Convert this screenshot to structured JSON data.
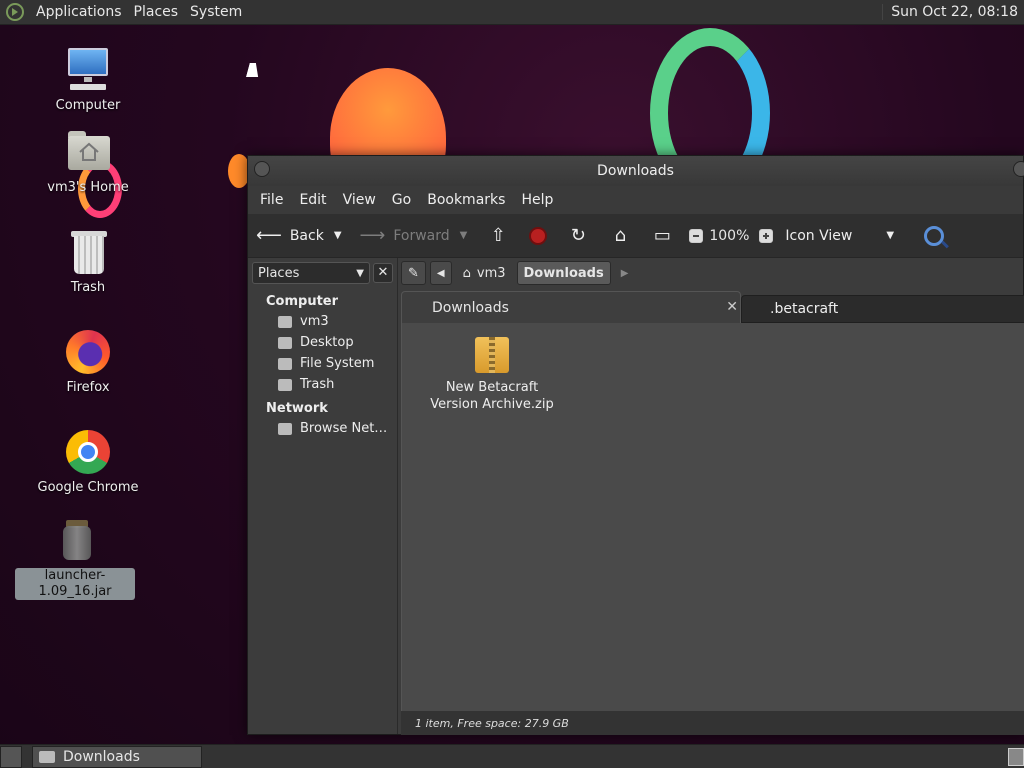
{
  "top_panel": {
    "menu": [
      "Applications",
      "Places",
      "System"
    ],
    "clock": "Sun Oct 22, 08:18"
  },
  "desktop": {
    "icons": [
      {
        "label": "Computer",
        "icon": "computer-icon"
      },
      {
        "label": "vm3's Home",
        "icon": "home-folder-icon"
      },
      {
        "label": "Trash",
        "icon": "trash-icon"
      },
      {
        "label": "Firefox",
        "icon": "firefox-icon"
      },
      {
        "label": "Google Chrome",
        "icon": "chrome-icon"
      },
      {
        "label": "launcher-1.09_16.jar",
        "icon": "jar-file-icon",
        "selected": true
      }
    ]
  },
  "window": {
    "title": "Downloads",
    "menu": [
      "File",
      "Edit",
      "View",
      "Go",
      "Bookmarks",
      "Help"
    ],
    "toolbar": {
      "back": "Back",
      "forward": "Forward",
      "zoom": "100%",
      "view_mode": "Icon View"
    },
    "sidebar": {
      "selector": "Places",
      "sections": [
        {
          "heading": "Computer",
          "items": [
            "vm3",
            "Desktop",
            "File System",
            "Trash"
          ]
        },
        {
          "heading": "Network",
          "items": [
            "Browse Net…"
          ]
        }
      ]
    },
    "pathbar": {
      "segments": [
        "vm3",
        "Downloads"
      ]
    },
    "tabs": [
      {
        "label": "Downloads",
        "active": true
      },
      {
        "label": ".betacraft",
        "active": false
      }
    ],
    "files": [
      {
        "name": "New Betacraft Version Archive.zip",
        "icon": "zip-archive-icon"
      }
    ],
    "status": "1 item, Free space: 27.9 GB"
  },
  "bottom_panel": {
    "task": "Downloads"
  },
  "colors": {
    "panel": "#333333",
    "window_bg": "#3c3c3c",
    "content_bg": "#4a4a4a",
    "desktop_bg": "#24071f"
  }
}
